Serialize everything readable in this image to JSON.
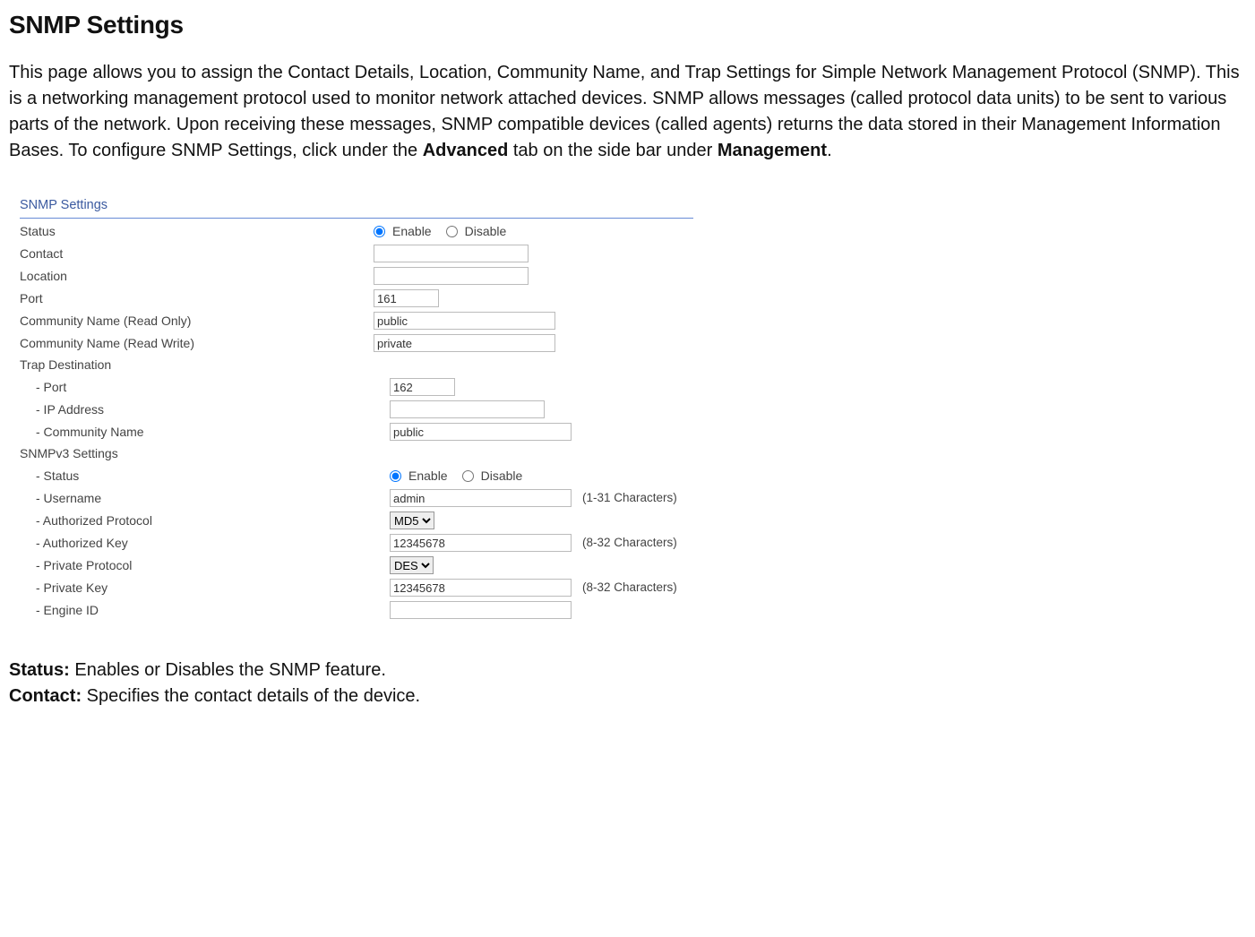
{
  "title": "SNMP Settings",
  "intro_pre": "This page allows you to assign the Contact Details, Location, Community Name, and Trap Settings for Simple Network Management Protocol (SNMP). This is a networking management protocol used to monitor network attached devices. SNMP allows messages (called protocol data units) to be sent to various parts of the network. Upon receiving these messages, SNMP compatible devices (called agents) returns the data stored in their Management Information Bases. To configure SNMP Settings, click under the ",
  "intro_b1": "Advanced",
  "intro_mid": " tab on the side bar under ",
  "intro_b2": "Management",
  "intro_post": ".",
  "panel": {
    "heading": "SNMP Settings",
    "enable": "Enable",
    "disable": "Disable",
    "labels": {
      "status": "Status",
      "contact": "Contact",
      "location": "Location",
      "port": "Port",
      "comm_ro": "Community Name (Read Only)",
      "comm_rw": "Community Name (Read Write)",
      "trap_dest": "Trap Destination",
      "trap_port": "- Port",
      "trap_ip": "- IP Address",
      "trap_comm": "- Community Name",
      "v3": "SNMPv3 Settings",
      "v3_status": "- Status",
      "v3_user": "- Username",
      "v3_auth_proto": "- Authorized Protocol",
      "v3_auth_key": "- Authorized Key",
      "v3_priv_proto": "- Private Protocol",
      "v3_priv_key": "- Private Key",
      "v3_engine": "- Engine ID"
    },
    "values": {
      "status_enabled": true,
      "contact": "",
      "location": "",
      "port": "161",
      "comm_ro": "public",
      "comm_rw": "private",
      "trap_port": "162",
      "trap_ip": "",
      "trap_comm": "public",
      "v3_status_enabled": true,
      "v3_user": "admin",
      "v3_auth_proto": "MD5",
      "v3_auth_key": "12345678",
      "v3_priv_proto": "DES",
      "v3_priv_key": "12345678",
      "v3_engine": ""
    },
    "hints": {
      "user": "(1-31 Characters)",
      "key": "(8-32 Characters)"
    }
  },
  "defs": {
    "status_label": "Status:",
    "status_text": " Enables or Disables the SNMP feature.",
    "contact_label": "Contact:",
    "contact_text": " Specifies the contact details of the device."
  }
}
